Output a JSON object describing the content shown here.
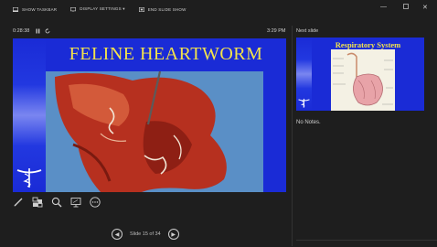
{
  "toolbar": {
    "show_taskbar": "SHOW TASKBAR",
    "display_settings": "DISPLAY SETTINGS ▾",
    "end_slide_show": "END SLIDE SHOW"
  },
  "window_controls": [
    "minimize-icon",
    "restore-icon",
    "close-icon"
  ],
  "status": {
    "timer": "0:28:38",
    "clock": "3:29 PM"
  },
  "current_slide": {
    "title": "FELINE HEARTWORM",
    "title_color": "#f3e34b",
    "background_color": "#1a2bd6"
  },
  "tools": [
    "pen-icon",
    "slides-grid-icon",
    "zoom-icon",
    "screen-icon",
    "more-icon"
  ],
  "navigation": {
    "slide_counter": "Slide 15 of 34"
  },
  "next_slide": {
    "label": "Next slide",
    "title": "Respiratory System"
  },
  "notes": {
    "text": "No Notes."
  }
}
